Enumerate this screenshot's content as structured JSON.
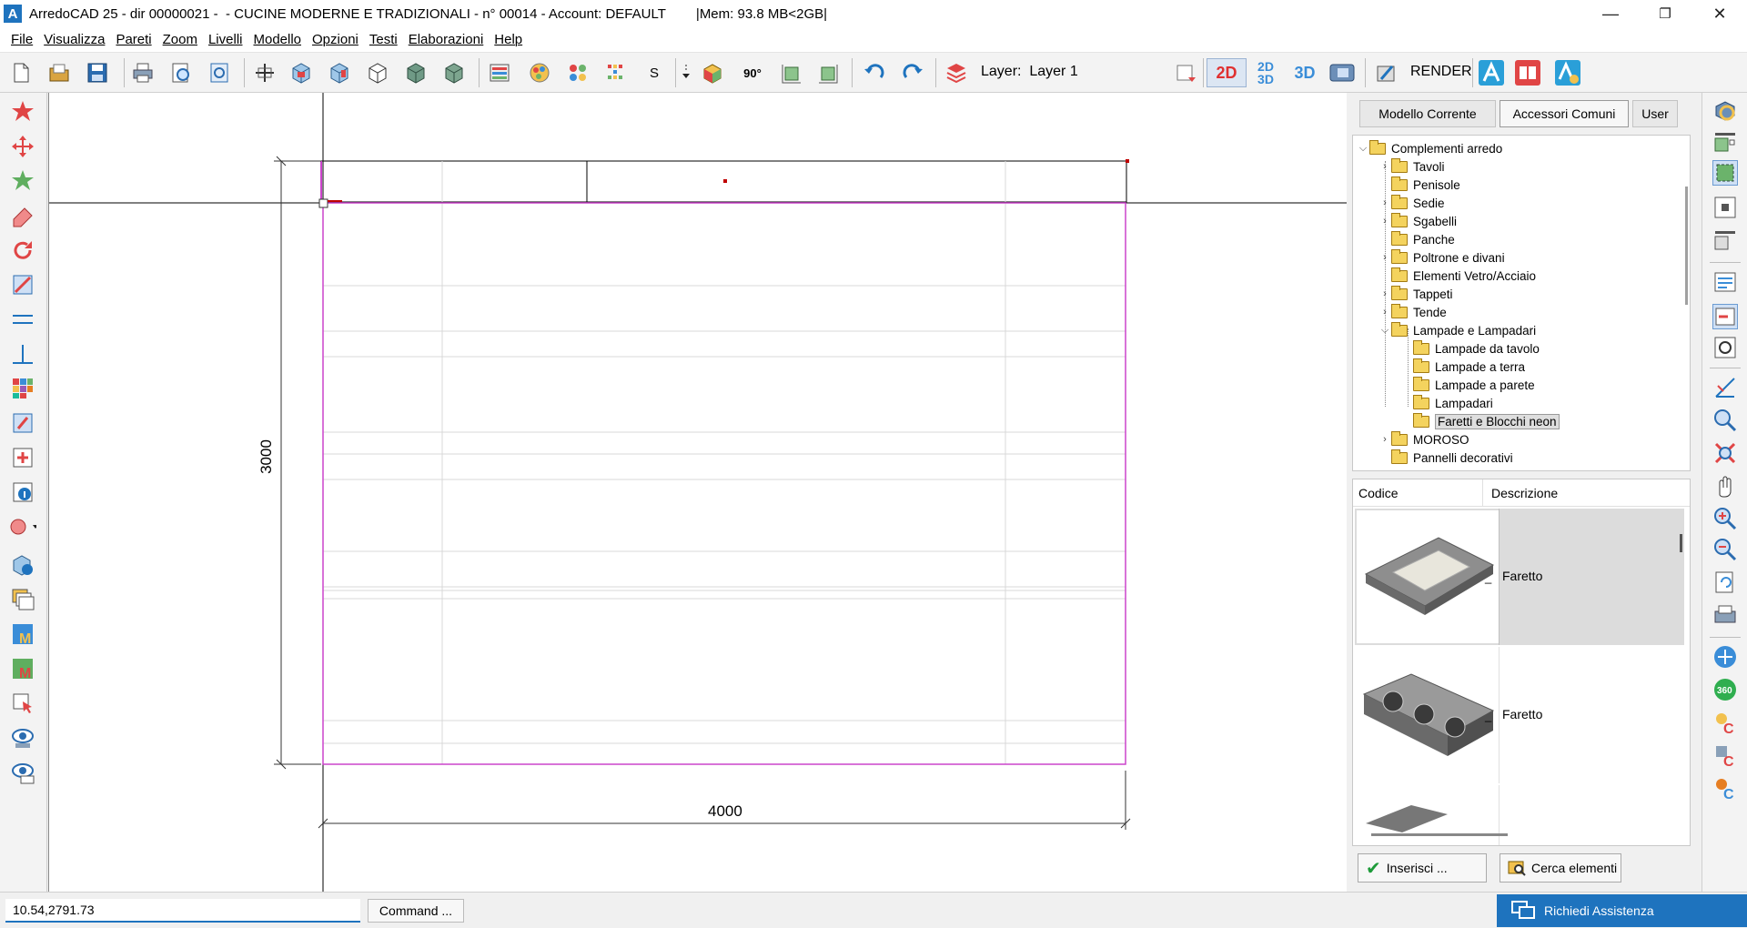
{
  "window": {
    "title": "ArredoCAD 25 - dir 00000021 -  - CUCINE MODERNE E TRADIZIONALI - n° 00014 - Account: DEFAULT        |Mem: 93.8 MB<2GB|",
    "app_icon_letter": "A",
    "minimize": "—",
    "maximize": "❐",
    "close": "✕"
  },
  "menu": [
    "File",
    "Visualizza",
    "Pareti",
    "Zoom",
    "Livelli",
    "Modello",
    "Opzioni",
    "Testi",
    "Elaborazioni",
    "Help"
  ],
  "toolbar": {
    "s_label": "S",
    "angle_label": "90°",
    "layer_label": "Layer:",
    "layer_value": "Layer 1",
    "view_2d": "2D",
    "view_2d3d_top": "2D",
    "view_2d3d_bottom": "3D",
    "view_3d": "3D",
    "render_label": "RENDER"
  },
  "drawing": {
    "dim_vertical": "3000",
    "dim_horizontal": "4000",
    "colors": {
      "room_outline": "#cc44cc",
      "grid_lines": "#d8d8d8",
      "axis": "#000000",
      "marker": "#c00000"
    }
  },
  "panel": {
    "tabs": [
      "Modello Corrente",
      "Accessori Comuni",
      "User"
    ],
    "active_tab": "Accessori Comuni",
    "tree": [
      {
        "label": "Complementi arredo",
        "level": 0,
        "chevron": "expanded"
      },
      {
        "label": "Tavoli",
        "level": 1,
        "chevron": "collapsed"
      },
      {
        "label": "Penisole",
        "level": 1,
        "chevron": "none"
      },
      {
        "label": "Sedie",
        "level": 1,
        "chevron": "collapsed"
      },
      {
        "label": "Sgabelli",
        "level": 1,
        "chevron": "collapsed"
      },
      {
        "label": "Panche",
        "level": 1,
        "chevron": "none"
      },
      {
        "label": "Poltrone e divani",
        "level": 1,
        "chevron": "collapsed"
      },
      {
        "label": "Elementi Vetro/Acciaio",
        "level": 1,
        "chevron": "none"
      },
      {
        "label": "Tappeti",
        "level": 1,
        "chevron": "collapsed"
      },
      {
        "label": "Tende",
        "level": 1,
        "chevron": "collapsed"
      },
      {
        "label": "Lampade e Lampadari",
        "level": 1,
        "chevron": "expanded"
      },
      {
        "label": "Lampade da tavolo",
        "level": 2,
        "chevron": "none"
      },
      {
        "label": "Lampade a terra",
        "level": 2,
        "chevron": "none"
      },
      {
        "label": "Lampade a parete",
        "level": 2,
        "chevron": "none"
      },
      {
        "label": "Lampadari",
        "level": 2,
        "chevron": "none"
      },
      {
        "label": "Faretti e Blocchi neon",
        "level": 2,
        "chevron": "none",
        "selected": true
      },
      {
        "label": "MOROSO",
        "level": 1,
        "chevron": "collapsed"
      },
      {
        "label": "Pannelli decorativi",
        "level": 1,
        "chevron": "none"
      }
    ],
    "list": {
      "col_code": "Codice",
      "col_desc": "Descrizione",
      "rows": [
        {
          "code": "_",
          "desc": "Faretto",
          "selected": true
        },
        {
          "code": "_",
          "desc": "Faretto",
          "selected": false
        }
      ]
    },
    "insert_button": "Inserisci ...",
    "search_button": "Cerca elementi"
  },
  "status": {
    "coordinates": "10.54,2791.73",
    "command_button": "Command ...",
    "assist_button": "Richiedi Assistenza"
  }
}
